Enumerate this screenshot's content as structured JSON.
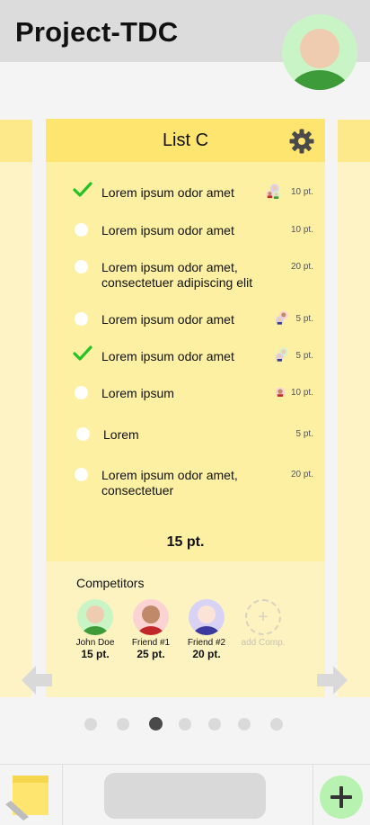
{
  "app": {
    "title": "Project-TDC"
  },
  "list": {
    "title": "List C",
    "tasks": [
      {
        "text": "Lorem ipsum odor amet",
        "points": "10 pt.",
        "done": true
      },
      {
        "text": "Lorem ipsum odor amet",
        "points": "10 pt.",
        "done": false
      },
      {
        "text": "Lorem ipsum odor amet, consectetuer adipiscing elit",
        "points": "20 pt.",
        "done": false
      },
      {
        "text": "Lorem ipsum odor amet",
        "points": "5 pt.",
        "done": false
      },
      {
        "text": "Lorem ipsum odor amet",
        "points": "5 pt.",
        "done": true
      },
      {
        "text": "Lorem ipsum",
        "points": "10 pt.",
        "done": false
      },
      {
        "text": "Lorem",
        "points": "5 pt.",
        "done": false
      },
      {
        "text": "Lorem ipsum odor amet, consectetuer",
        "points": "20 pt.",
        "done": false
      }
    ],
    "total": "15 pt."
  },
  "competitors": {
    "title": "Competitors",
    "people": [
      {
        "name": "John Doe",
        "score": "15 pt."
      },
      {
        "name": "Friend #1",
        "score": "25 pt."
      },
      {
        "name": "Friend #2",
        "score": "20 pt."
      }
    ],
    "add_label": "add Comp."
  },
  "pager": {
    "count": 7,
    "active_index": 2
  },
  "colors": {
    "card_header": "#fde56f",
    "card_body": "#fdf0a3",
    "check": "#22c322",
    "fab": "#b7f2b1"
  },
  "icons": [
    "gear-icon",
    "check-icon",
    "arrow-left-icon",
    "arrow-right-icon",
    "note-icon",
    "plus-icon"
  ]
}
